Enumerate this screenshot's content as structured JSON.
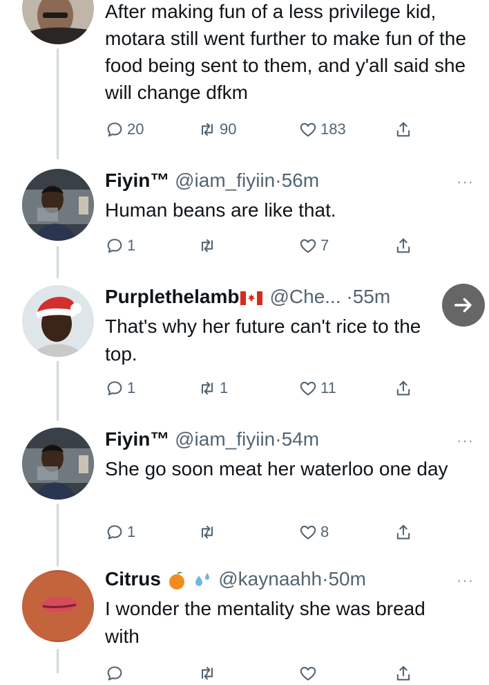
{
  "tweets": [
    {
      "name": "",
      "handle": "",
      "time": "",
      "text": "After making fun of a less privilege kid, motara still went further to make fun of the food being sent to them, and y'all said she will change dfkm",
      "replies": "20",
      "retweets": "90",
      "likes": "183"
    },
    {
      "name": "Fiyin™",
      "handle": "@iam_fiyiin",
      "dot": "·",
      "time": "56m",
      "text": "Human beans are like that.",
      "replies": "1",
      "retweets": "",
      "likes": "7",
      "more": "···"
    },
    {
      "name": "Purplethelamb",
      "flag": "canada-flag",
      "handle": "@Che...",
      "dot": "·",
      "time": "55m",
      "text": "That's why her future can't rice to the top.",
      "replies": "1",
      "retweets": "1",
      "likes": "11",
      "more": "···"
    },
    {
      "name": "Fiyin™",
      "handle": "@iam_fiyiin",
      "dot": "·",
      "time": "54m",
      "text": "She go soon meat her waterloo one day",
      "replies": "1",
      "retweets": "",
      "likes": "8",
      "more": "···"
    },
    {
      "name": "Citrus",
      "emoji": [
        "tangerine-emoji",
        "sweat-droplets-emoji"
      ],
      "handle": "@kaynaahh",
      "dot": "·",
      "time": "50m",
      "text": "I wonder the mentality she was bread with",
      "more": "···"
    }
  ],
  "colors": {
    "text": "#0f1419",
    "secondary": "#536471",
    "thread_line": "#cfd9de",
    "fab_bg": "#5a5a5a"
  },
  "icons": [
    "reply-icon",
    "retweet-icon",
    "like-icon",
    "share-icon",
    "more-icon",
    "arrow-right-icon"
  ]
}
